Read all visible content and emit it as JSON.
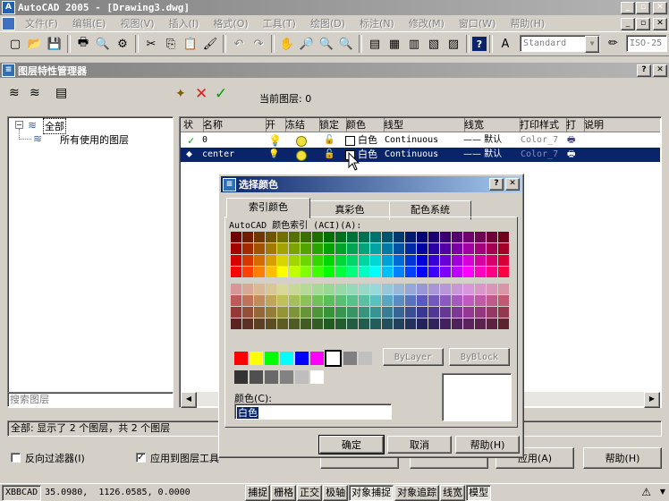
{
  "app": {
    "title": "AutoCAD 2005 - [Drawing3.dwg]",
    "icon_label": "A"
  },
  "menu": [
    "文件(F)",
    "编辑(E)",
    "视图(V)",
    "插入(I)",
    "格式(O)",
    "工具(T)",
    "绘图(D)",
    "标注(N)",
    "修改(M)",
    "窗口(W)",
    "帮助(H)"
  ],
  "toolbar": {
    "text_style": "Standard",
    "dim_style": "ISO-25"
  },
  "layer_manager": {
    "title": "图层特性管理器",
    "current_layer": "当前图层: 0",
    "tree": {
      "root": "全部",
      "child": "所有使用的图层"
    },
    "search_placeholder": "搜索图层",
    "status_text": "全部: 显示了 2 个图层，共 2 个图层",
    "invert_filter": "反向过滤器(I)",
    "apply_to_toolbar": "应用到图层工具",
    "apply_button": "应用(A)",
    "help_button": "帮助(H)",
    "columns": [
      "状",
      "名称",
      "开",
      "冻结",
      "锁定",
      "颜色",
      "线型",
      "线宽",
      "打印样式",
      "打",
      "说明"
    ],
    "layers": [
      {
        "status": "✓",
        "name": "0",
        "color_name": "白色",
        "linetype": "Continuous",
        "lineweight": "—— 默认",
        "plot_style": "Color_7"
      },
      {
        "status": "⬥",
        "name": "center",
        "color_name": "白色",
        "linetype": "Continuous",
        "lineweight": "—— 默认",
        "plot_style": "Color_7"
      }
    ]
  },
  "color_dialog": {
    "title": "选择颜色",
    "tabs": [
      "索引颜色",
      "真彩色",
      "配色系统"
    ],
    "aci_label": "AutoCAD 颜色索引 (ACI)(A):",
    "bylayer": "ByLayer",
    "byblock": "ByBlock",
    "color_label": "颜色(C):",
    "color_value": "白色",
    "ok": "确定",
    "cancel": "取消",
    "help": "帮助(H)"
  },
  "statusbar": {
    "coords": "35.0980,  1126.0585, 0.0000",
    "xbbcad": "XBBCAD",
    "toggles": [
      "捕捉",
      "栅格",
      "正交",
      "极轴",
      "对象捕捉",
      "对象追踪",
      "线宽",
      "模型"
    ]
  }
}
